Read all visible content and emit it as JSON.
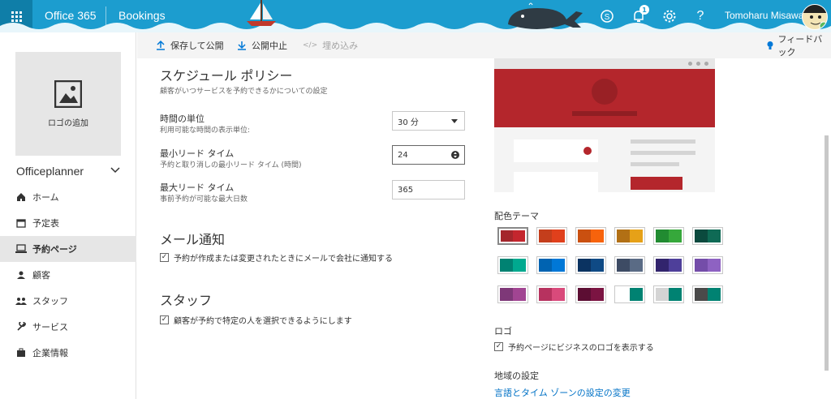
{
  "topbar": {
    "brand": "Office 365",
    "app": "Bookings",
    "notification_count": "1",
    "user_name": "Tomoharu Misawa",
    "colors": {
      "bar": "#1c9dcf",
      "waffle": "#0f7ea8"
    }
  },
  "sidebar": {
    "logo_label": "ロゴの追加",
    "business_name": "Officeplanner",
    "items": [
      {
        "label": "ホーム",
        "icon": "home-icon"
      },
      {
        "label": "予定表",
        "icon": "calendar-icon"
      },
      {
        "label": "予約ページ",
        "icon": "laptop-icon",
        "active": true
      },
      {
        "label": "顧客",
        "icon": "person-icon"
      },
      {
        "label": "スタッフ",
        "icon": "people-icon"
      },
      {
        "label": "サービス",
        "icon": "wrench-icon"
      },
      {
        "label": "企業情報",
        "icon": "briefcase-icon"
      }
    ]
  },
  "commandbar": {
    "save_publish": "保存して公開",
    "unpublish": "公開中止",
    "embed": "埋め込み",
    "feedback": "フィードバック"
  },
  "policy": {
    "title": "スケジュール ポリシー",
    "subtitle": "顧客がいつサービスを予約できるかについての設定",
    "time_unit": {
      "label": "時間の単位",
      "hint": "利用可能な時間の表示単位:",
      "value": "30 分"
    },
    "min_lead": {
      "label": "最小リード タイム",
      "hint": "予約と取り消しの最小リード タイム (時間)",
      "value": "24"
    },
    "max_lead": {
      "label": "最大リード タイム",
      "hint": "事前予約が可能な最大日数",
      "value": "365"
    }
  },
  "email": {
    "title": "メール通知",
    "checkbox": "予約が作成または変更されたときにメールで会社に通知する",
    "checked": true
  },
  "staff": {
    "title": "スタッフ",
    "checkbox": "顧客が予約で特定の人を選択できるようにします",
    "checked": true
  },
  "theme": {
    "label": "配色テーマ",
    "selected_index": 0,
    "swatches": [
      [
        "#a4262c",
        "#c4262e"
      ],
      [
        "#c43e1c",
        "#e0401c"
      ],
      [
        "#ca5010",
        "#f7630c"
      ],
      [
        "#b27015",
        "#e6a118"
      ],
      [
        "#218b31",
        "#36a83b"
      ],
      [
        "#0b4a3e",
        "#0f6a55"
      ],
      [
        "#008272",
        "#00a98f"
      ],
      [
        "#0063b1",
        "#0078d7"
      ],
      [
        "#0b3361",
        "#0f4a85"
      ],
      [
        "#3d4b64",
        "#5a6b85"
      ],
      [
        "#32246d",
        "#4e3f9a"
      ],
      [
        "#744da9",
        "#8e62c2"
      ],
      [
        "#7e3878",
        "#a14592"
      ],
      [
        "#b7325f",
        "#d94a7b"
      ],
      [
        "#5c0e33",
        "#7b1442"
      ],
      [
        "#ffffff",
        "#008272"
      ],
      [
        "#d4d4d4",
        "#008272"
      ],
      [
        "#4a4a4a",
        "#008272"
      ]
    ],
    "preview_accent": "#b4262c"
  },
  "logo_section": {
    "label": "ロゴ",
    "checkbox": "予約ページにビジネスのロゴを表示する",
    "checked": true
  },
  "region": {
    "label": "地域の設定",
    "link": "言語とタイム ゾーンの設定の変更"
  }
}
